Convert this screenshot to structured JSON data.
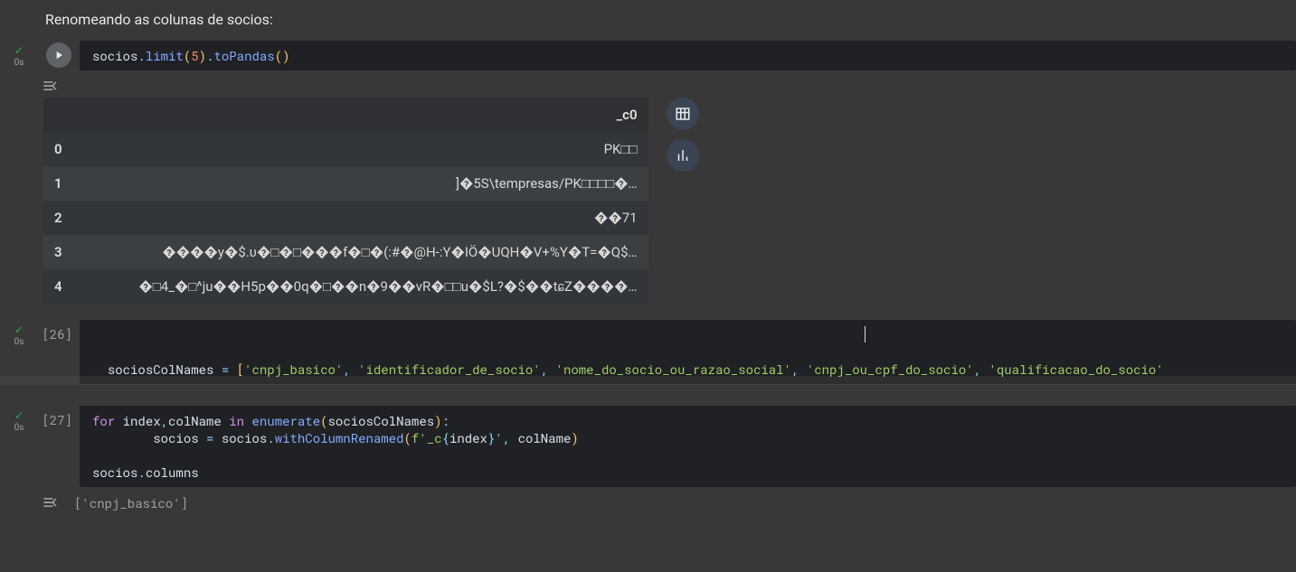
{
  "markdown": "Renomeando as colunas de socios:",
  "cell1": {
    "exec_time": "0s",
    "prompt": "",
    "code_html": "<span class='tok-id'>socios</span><span class='tok-op'>.</span><span class='tok-fn'>limit</span><span class='tok-paren'>(</span><span class='tok-num'>5</span><span class='tok-paren'>)</span><span class='tok-op'>.</span><span class='tok-fn'>toPandas</span><span class='tok-paren'>()</span>",
    "table": {
      "header": "_c0",
      "rows": [
        {
          "idx": "0",
          "val": "PK□□"
        },
        {
          "idx": "1",
          "val": "]�5S\\tempresas/PK□□□□�…"
        },
        {
          "idx": "2",
          "val": "��71"
        },
        {
          "idx": "3",
          "val": "����y�$.ʋ�□�□���f�□�(:#�@H-:Y�IÖ�UQH�V+%Y�T=�Q$…"
        },
        {
          "idx": "4",
          "val": "�□4_�□^ju��H5p��0q�□��n�9��vR�□□u�$L?�$��tɕZ����…"
        }
      ]
    }
  },
  "cell2": {
    "exec_time": "0s",
    "prompt": "[26]",
    "code_html": "<span class='tok-id'>sociosColNames</span> <span class='tok-op'>=</span> <span class='tok-paren'>[</span><span class='tok-str'>'cnpj_basico'</span><span class='tok-op'>,</span> <span class='tok-str'>'identificador_de_socio'</span><span class='tok-op'>,</span> <span class='tok-str'>'nome_do_socio_ou_razao_social'</span><span class='tok-op'>,</span> <span class='tok-str'>'cnpj_ou_cpf_do_socio'</span><span class='tok-op'>,</span> <span class='tok-str'>'qualificacao_do_socio'</span>"
  },
  "cell3": {
    "exec_time": "0s",
    "prompt": "[27]",
    "code_html": "<span class='tok-kw'>for</span> <span class='tok-id'>index</span><span class='tok-op'>,</span><span class='tok-id'>colName</span> <span class='tok-kw'>in</span> <span class='tok-fn'>enumerate</span><span class='tok-paren'>(</span><span class='tok-id'>sociosColNames</span><span class='tok-paren'>)</span><span class='tok-op'>:</span>\n        <span class='tok-id'>socios</span> <span class='tok-op'>=</span> <span class='tok-id'>socios</span><span class='tok-op'>.</span><span class='tok-fn'>withColumnRenamed</span><span class='tok-paren'>(</span><span class='tok-str'>f'_c</span><span class='tok-op'>{</span><span class='tok-id'>index</span><span class='tok-op'>}</span><span class='tok-str'>'</span><span class='tok-op'>,</span> <span class='tok-id'>colName</span><span class='tok-paren'>)</span>\n\n<span class='tok-id'>socios</span><span class='tok-op'>.</span><span class='tok-id'>columns</span>",
    "output": "['cnpj_basico']"
  }
}
